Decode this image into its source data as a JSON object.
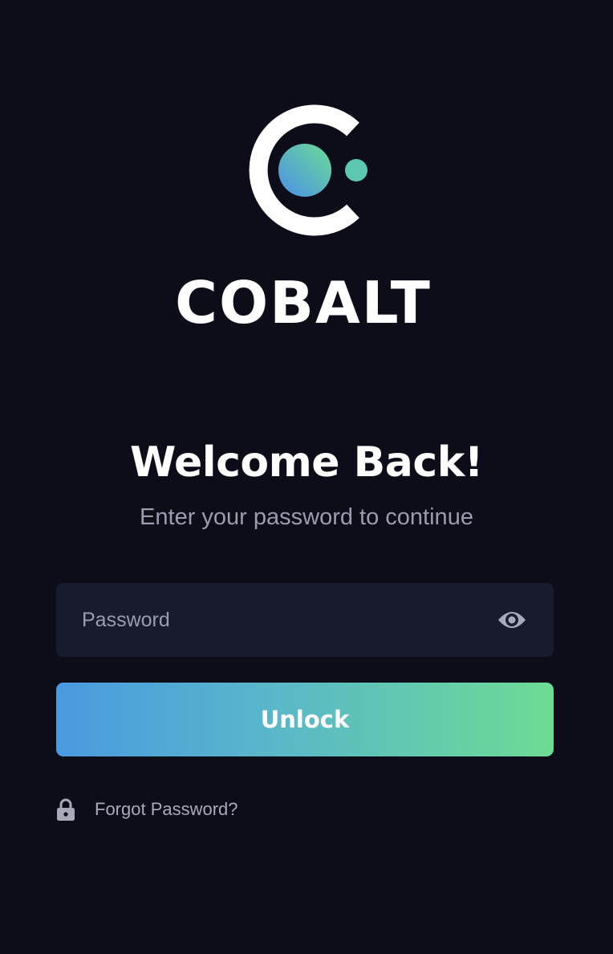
{
  "brand": {
    "name": "COBALT",
    "logo_icon": "cobalt-logo-icon"
  },
  "welcome": {
    "title": "Welcome Back!",
    "subtitle": "Enter your password to continue"
  },
  "password": {
    "placeholder": "Password",
    "value": "",
    "toggle_icon": "eye-icon"
  },
  "actions": {
    "unlock_label": "Unlock",
    "forgot_label": "Forgot Password?",
    "forgot_icon": "lock-icon"
  },
  "colors": {
    "background": "#0d0d1a",
    "field_background": "#181a2e",
    "gradient_start": "#4a9ae0",
    "gradient_end": "#6cdc94",
    "muted_text": "#9a9cb0"
  }
}
